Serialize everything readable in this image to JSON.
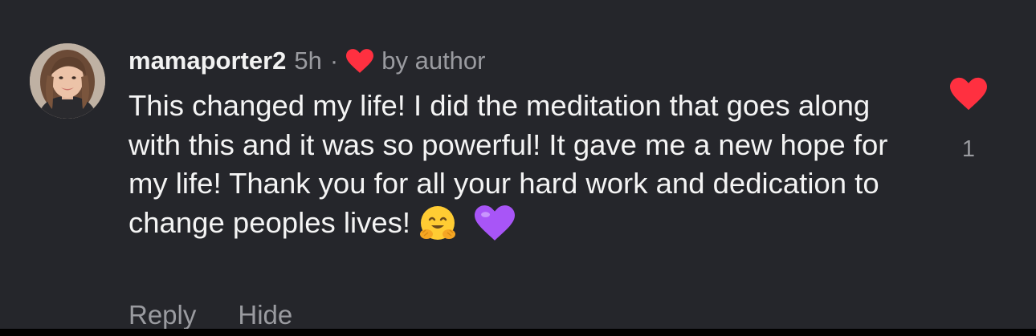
{
  "comment": {
    "username": "mamaporter2",
    "time": "5h",
    "separator": "·",
    "author_like_label": "by author",
    "text": "This changed my life! I did the meditation that goes along with this and it was so powerful! It gave me a new hope for my life! Thank you for all your hard work and dedication to change peoples lives!",
    "emojis": [
      "hugging-face-emoji",
      "purple-heart-emoji"
    ],
    "like_count": "1",
    "actions": {
      "reply_label": "Reply",
      "hide_label": "Hide"
    }
  },
  "colors": {
    "background": "#25262b",
    "heart_red": "#ff3040",
    "secondary_text": "#9a9ba0",
    "purple_heart": "#a855f7"
  },
  "icons": {
    "author_heart": "heart-icon",
    "like_button": "heart-icon",
    "avatar": "user-avatar"
  }
}
